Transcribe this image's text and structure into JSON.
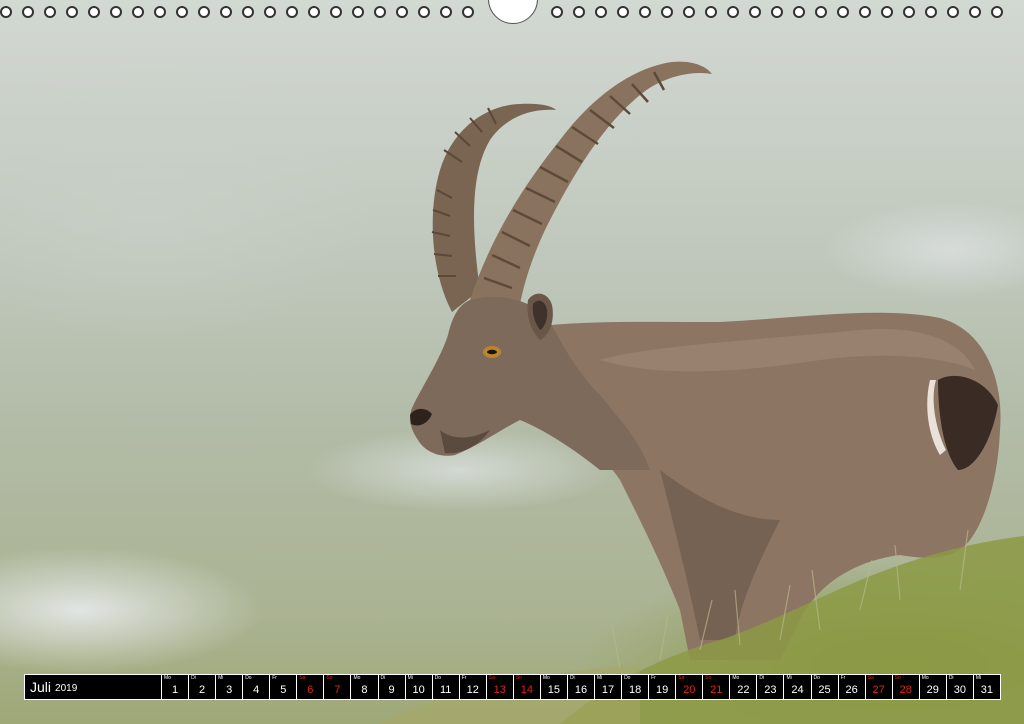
{
  "colors": {
    "weekday_text": "#ffffff",
    "weekend_text": "#e2231a",
    "strip_background": "#000000"
  },
  "photo": {
    "subject_icon": "ibex-photo"
  },
  "calendar": {
    "month": "Juli",
    "year": "2019",
    "days": [
      {
        "wd": "Mo",
        "n": "1",
        "weekend": false
      },
      {
        "wd": "Di",
        "n": "2",
        "weekend": false
      },
      {
        "wd": "Mi",
        "n": "3",
        "weekend": false
      },
      {
        "wd": "Do",
        "n": "4",
        "weekend": false
      },
      {
        "wd": "Fr",
        "n": "5",
        "weekend": false
      },
      {
        "wd": "Sa",
        "n": "6",
        "weekend": true
      },
      {
        "wd": "So",
        "n": "7",
        "weekend": true
      },
      {
        "wd": "Mo",
        "n": "8",
        "weekend": false
      },
      {
        "wd": "Di",
        "n": "9",
        "weekend": false
      },
      {
        "wd": "Mi",
        "n": "10",
        "weekend": false
      },
      {
        "wd": "Do",
        "n": "11",
        "weekend": false
      },
      {
        "wd": "Fr",
        "n": "12",
        "weekend": false
      },
      {
        "wd": "Sa",
        "n": "13",
        "weekend": true
      },
      {
        "wd": "So",
        "n": "14",
        "weekend": true
      },
      {
        "wd": "Mo",
        "n": "15",
        "weekend": false
      },
      {
        "wd": "Di",
        "n": "16",
        "weekend": false
      },
      {
        "wd": "Mi",
        "n": "17",
        "weekend": false
      },
      {
        "wd": "Do",
        "n": "18",
        "weekend": false
      },
      {
        "wd": "Fr",
        "n": "19",
        "weekend": false
      },
      {
        "wd": "Sa",
        "n": "20",
        "weekend": true
      },
      {
        "wd": "So",
        "n": "21",
        "weekend": true
      },
      {
        "wd": "Mo",
        "n": "22",
        "weekend": false
      },
      {
        "wd": "Di",
        "n": "23",
        "weekend": false
      },
      {
        "wd": "Mi",
        "n": "24",
        "weekend": false
      },
      {
        "wd": "Do",
        "n": "25",
        "weekend": false
      },
      {
        "wd": "Fr",
        "n": "26",
        "weekend": false
      },
      {
        "wd": "Sa",
        "n": "27",
        "weekend": true
      },
      {
        "wd": "So",
        "n": "28",
        "weekend": true
      },
      {
        "wd": "Mo",
        "n": "29",
        "weekend": false
      },
      {
        "wd": "Di",
        "n": "30",
        "weekend": false
      },
      {
        "wd": "Mi",
        "n": "31",
        "weekend": false
      }
    ]
  }
}
